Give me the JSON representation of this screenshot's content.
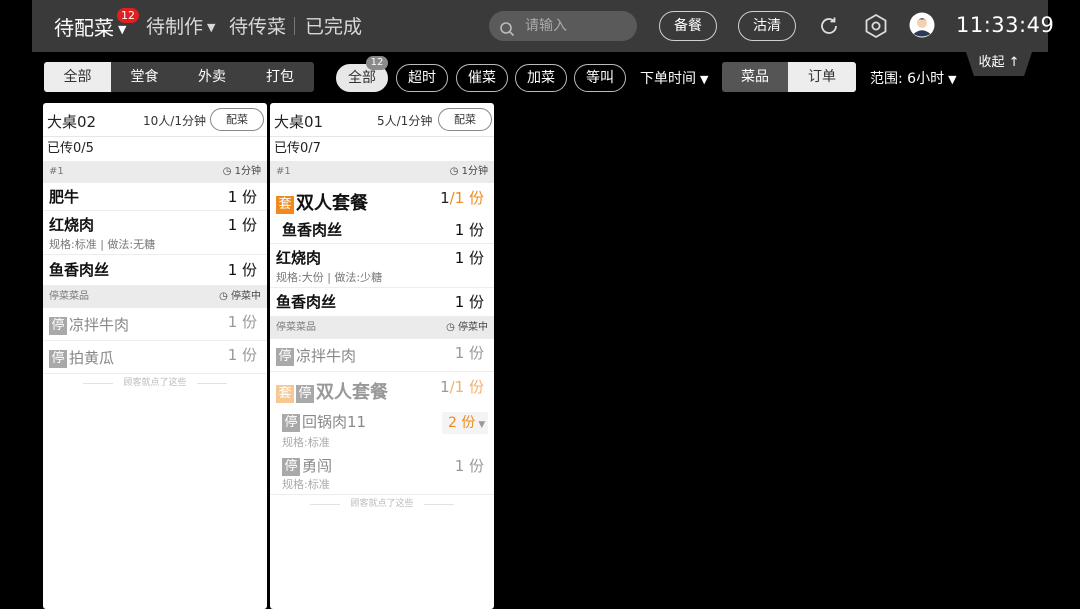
{
  "header": {
    "tabs": [
      {
        "label": "待配菜",
        "badge": "12"
      },
      {
        "label": "待制作"
      },
      {
        "label": "待传菜"
      },
      {
        "label": "已完成"
      }
    ],
    "search_placeholder": "请输入",
    "buttons": {
      "prep": "备餐",
      "clear": "沽清"
    },
    "icons": [
      "refresh-icon",
      "settings-icon",
      "avatar-icon"
    ],
    "time": "11:33:49"
  },
  "filters": {
    "order_types": [
      "全部",
      "堂食",
      "外卖",
      "打包"
    ],
    "chips": [
      {
        "label": "全部",
        "badge": "12"
      },
      {
        "label": "超时"
      },
      {
        "label": "催菜"
      },
      {
        "label": "加菜"
      },
      {
        "label": "等叫"
      }
    ],
    "sort_label": "下单时间",
    "view_modes": [
      "菜品",
      "订单"
    ],
    "range_label": "范围: 6小时",
    "collapse_label": "收起 ↑"
  },
  "cards": [
    {
      "table": "大桌02",
      "info": "10人/1分钟",
      "action": "配菜",
      "served": "已传0/5",
      "group": {
        "label": "#1",
        "time": "1分钟"
      },
      "items": [
        {
          "name": "肥牛",
          "qty": "1 份"
        },
        {
          "name": "红烧肉",
          "qty": "1 份",
          "spec": "规格:标准 | 做法:无糖"
        },
        {
          "name": "鱼香肉丝",
          "qty": "1 份"
        }
      ],
      "stopped_group": {
        "label": "停菜菜品",
        "status": "停菜中"
      },
      "stopped_items": [
        {
          "tag": "停",
          "name": "凉拌牛肉",
          "qty": "1 份"
        },
        {
          "tag": "停",
          "name": "拍黄瓜",
          "qty": "1 份"
        }
      ],
      "footnote": "顾客就点了这些"
    },
    {
      "table": "大桌01",
      "info": "5人/1分钟",
      "action": "配菜",
      "served": "已传0/7",
      "group": {
        "label": "#1",
        "time": "1分钟"
      },
      "set_item": {
        "tag": "套",
        "name": "双人套餐",
        "qty_cur": "1",
        "qty_total": "/1 份"
      },
      "items": [
        {
          "name": "鱼香肉丝",
          "qty": "1 份"
        },
        {
          "name": "红烧肉",
          "qty": "1 份",
          "spec": "规格:大份 | 做法:少糖"
        },
        {
          "name": "鱼香肉丝",
          "qty": "1 份"
        }
      ],
      "stopped_group": {
        "label": "停菜菜品",
        "status": "停菜中"
      },
      "stopped_items": [
        {
          "tag": "停",
          "name": "凉拌牛肉",
          "qty": "1 份"
        }
      ],
      "stopped_set": {
        "tag1": "套",
        "tag2": "停",
        "name": "双人套餐",
        "qty_cur": "1",
        "qty_total": "/1 份"
      },
      "stopped_sub_items": [
        {
          "tag": "停",
          "name": "回锅肉11",
          "qty": "2 份",
          "spec": "规格:标准"
        },
        {
          "tag": "停",
          "name": "勇闯",
          "qty": "1 份",
          "spec": "规格:标准"
        }
      ],
      "footnote": "顾客就点了这些"
    }
  ]
}
